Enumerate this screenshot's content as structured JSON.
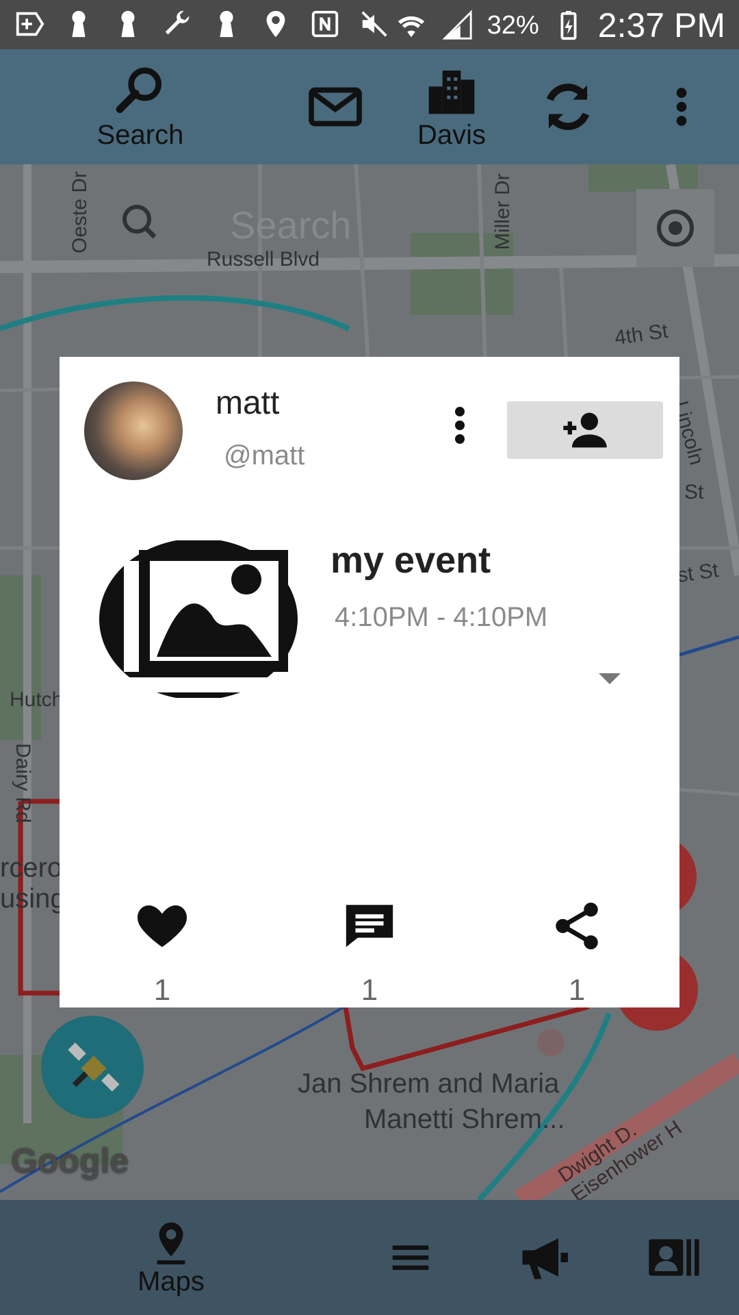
{
  "status_bar": {
    "icons": [
      "add-box-icon",
      "keyhole-icon",
      "keyhole-icon",
      "wrench-icon",
      "keyhole-icon",
      "location-pin-icon",
      "nfc-icon",
      "mute-icon",
      "wifi-icon",
      "signal-icon",
      "battery-charging-icon"
    ],
    "battery": "32%",
    "time": "2:37 PM"
  },
  "top_bar": {
    "search_label": "Search",
    "city_label": "Davis",
    "icons": [
      "search-icon",
      "mail-icon",
      "city-icon",
      "refresh-icon",
      "more-vert-icon"
    ],
    "background": "#4a6b7e"
  },
  "map": {
    "search_placeholder": "Search",
    "labels": {
      "oeste": "Oeste Dr",
      "miller": "Miller Dr",
      "russell": "Russell Blvd",
      "fourth": "4th St",
      "lincoln": "Lincoln Hwy",
      "st1": "St",
      "st2": "st St",
      "hutch": "Hutch",
      "dairy": "Dairy Rd",
      "rcero": "rcero",
      "using": "using",
      "jan1": "Jan Shrem and Maria",
      "jan2": "Manetti Shrem...",
      "eisenhower": "Dwight D. Eisenhower H",
      "google": "Google"
    }
  },
  "card": {
    "username": "matt",
    "handle": "@matt",
    "event_title": "my event",
    "event_time": "4:10PM - 4:10PM",
    "like_count": "1",
    "comment_count": "1",
    "share_count": "1"
  },
  "bottom_bar": {
    "maps_label": "Maps",
    "icons": [
      "location-pin-icon",
      "menu-icon",
      "megaphone-icon",
      "contact-list-icon"
    ],
    "background": "#3f5463"
  }
}
